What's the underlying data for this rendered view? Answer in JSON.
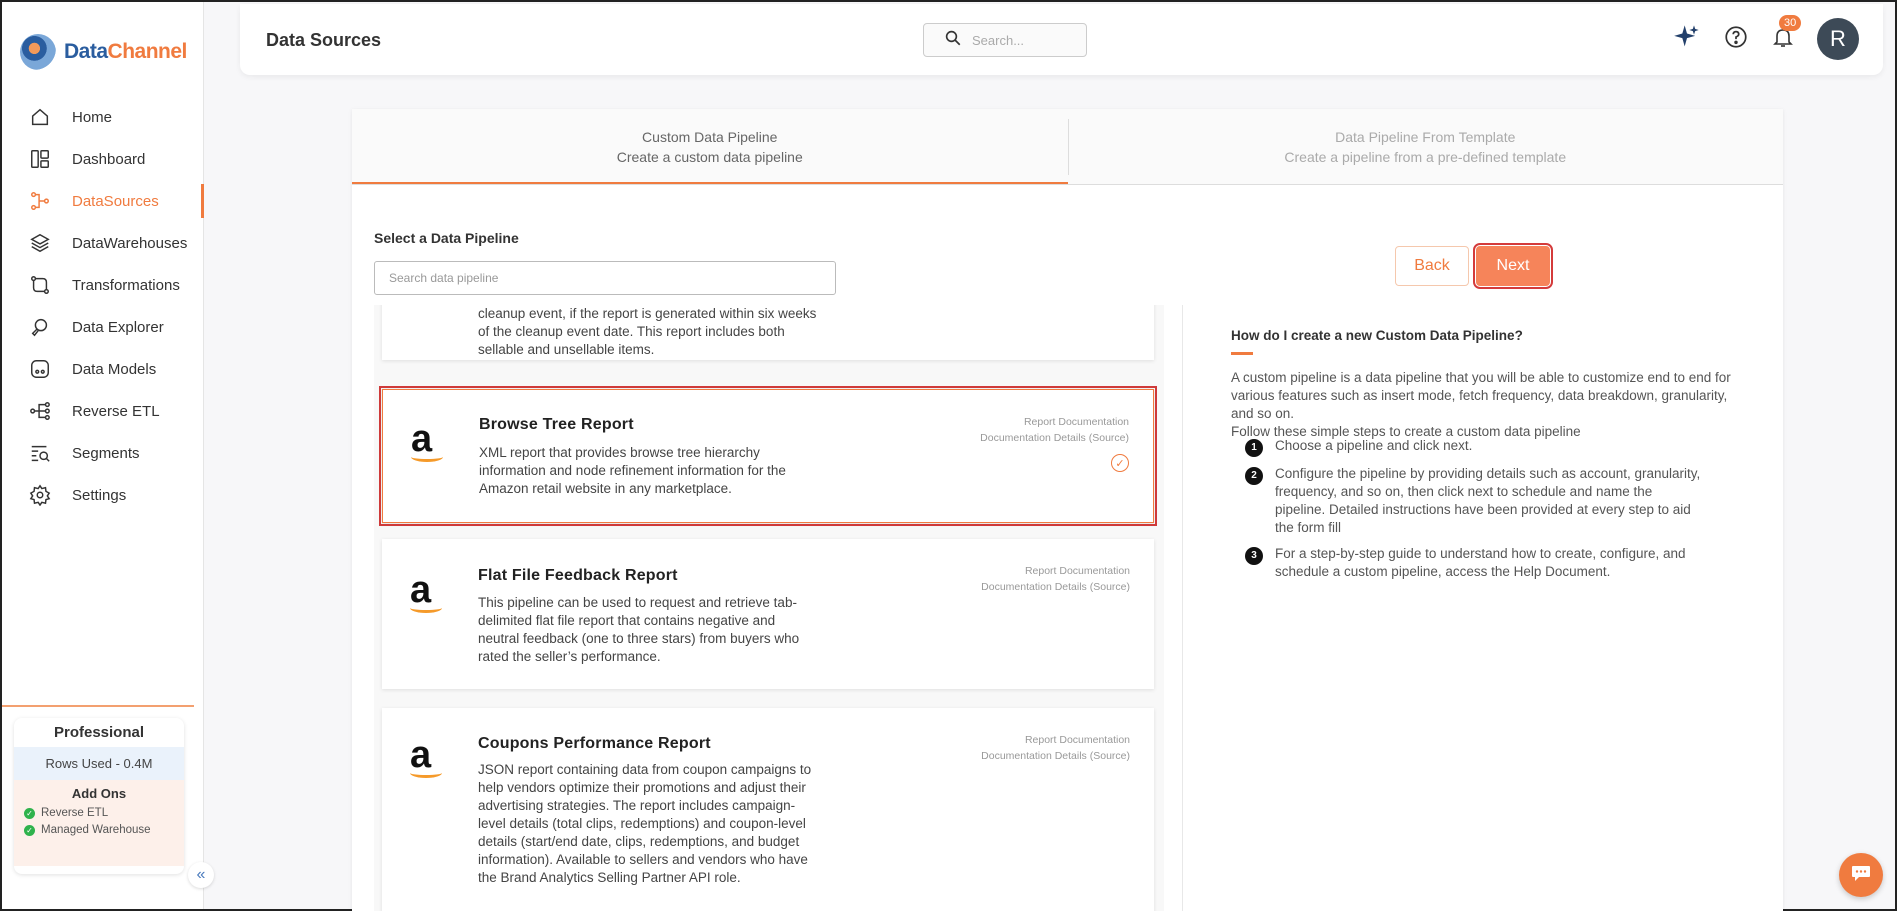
{
  "brand": {
    "name_part1": "Data",
    "name_part2": "Channel"
  },
  "nav": [
    {
      "label": "Home",
      "icon": "home-icon",
      "active": false
    },
    {
      "label": "Dashboard",
      "icon": "dashboard-icon",
      "active": false
    },
    {
      "label": "DataSources",
      "icon": "datasources-icon",
      "active": true
    },
    {
      "label": "DataWarehouses",
      "icon": "layers-icon",
      "active": false
    },
    {
      "label": "Transformations",
      "icon": "transform-icon",
      "active": false
    },
    {
      "label": "Data Explorer",
      "icon": "explorer-icon",
      "active": false
    },
    {
      "label": "Data Models",
      "icon": "models-icon",
      "active": false
    },
    {
      "label": "Reverse ETL",
      "icon": "reverse-etl-icon",
      "active": false
    },
    {
      "label": "Segments",
      "icon": "segments-icon",
      "active": false
    },
    {
      "label": "Settings",
      "icon": "gear-icon",
      "active": false
    }
  ],
  "plan": {
    "title": "Professional",
    "rows_used": "Rows Used - 0.4M",
    "addons_title": "Add Ons",
    "addons": [
      "Reverse ETL",
      "Managed Warehouse"
    ]
  },
  "header": {
    "title": "Data Sources",
    "search_placeholder": "Search...",
    "notification_count": "30",
    "avatar_initial": "R"
  },
  "tabs": [
    {
      "title": "Custom Data Pipeline",
      "subtitle": "Create a custom data pipeline",
      "active": true
    },
    {
      "title": "Data Pipeline From Template",
      "subtitle": "Create a pipeline from a pre-defined template",
      "active": false
    }
  ],
  "select_label": "Select a Data Pipeline",
  "pipeline_search_placeholder": "Search data pipeline",
  "buttons": {
    "back": "Back",
    "next": "Next"
  },
  "partial_item_desc": "cleanup event, if the report is generated within six weeks of the cleanup event date. This report includes both sellable and unsellable items.",
  "items": [
    {
      "title": "Browse Tree Report",
      "desc": "XML report that provides browse tree hierarchy information and node refinement information for the Amazon retail website in any marketplace.",
      "link1": "Report Documentation",
      "link2": "Documentation Details (Source)",
      "selected": true
    },
    {
      "title": "Flat File Feedback Report",
      "desc": "This pipeline can be used to request and retrieve tab-delimited flat file report that contains negative and neutral feedback (one to three stars) from buyers who rated the seller’s performance.",
      "link1": "Report Documentation",
      "link2": "Documentation Details (Source)",
      "selected": false
    },
    {
      "title": "Coupons Performance Report",
      "desc": "JSON report containing data from coupon campaigns to help vendors optimize their promotions and adjust their advertising strategies. The report includes campaign-level details (total clips, redemptions) and coupon-level details (start/end date, clips, redemptions, and budget information). Available to sellers and vendors who have the Brand Analytics Selling Partner API role.",
      "link1": "Report Documentation",
      "link2": "Documentation Details (Source)",
      "selected": false
    }
  ],
  "help": {
    "title": "How do I create a new Custom Data Pipeline?",
    "intro1": "A custom pipeline is a data pipeline that you will be able to customize end to end for various features such as insert mode, fetch frequency, data breakdown, granularity, and so on.",
    "intro2": "Follow these simple steps to create a custom data pipeline",
    "steps": [
      {
        "n": "1",
        "text": "Choose a pipeline and click next."
      },
      {
        "n": "2",
        "text": "Configure the pipeline by providing details such as account, granularity, frequency, and so on, then click next to schedule and name the pipeline. Detailed instructions have been provided at every step to aid the form fill"
      },
      {
        "n": "3",
        "text": "For a step-by-step guide to understand how to create, configure, and schedule a custom pipeline, access the Help Document."
      }
    ]
  },
  "colors": {
    "accent": "#f07b3f",
    "brand_blue": "#2a5d9f"
  }
}
